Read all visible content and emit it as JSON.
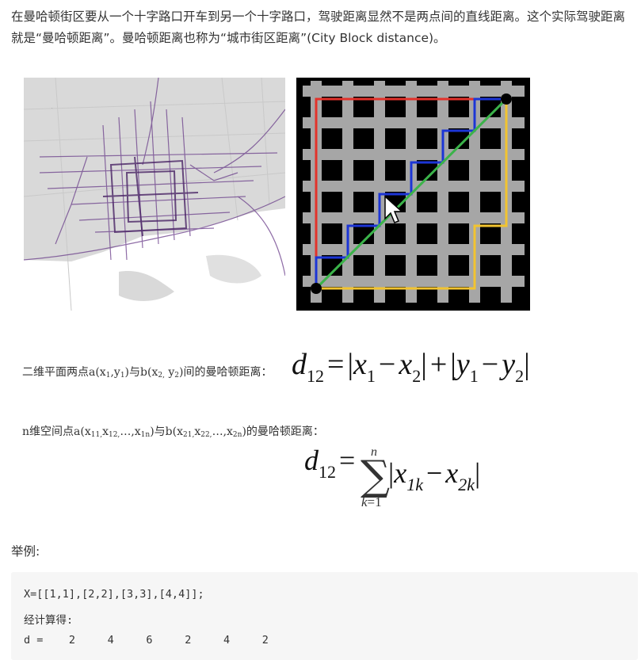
{
  "intro": {
    "paragraph": "在曼哈顿街区要从一个十字路口开车到另一个十字路口，驾驶距离显然不是两点间的直线距离。这个实际驾驶距离就是“曼哈顿距离”。曼哈顿距离也称为“城市街区距离”(City Block distance)。"
  },
  "images": {
    "left": "city-trajectory-map",
    "right": "manhattan-grid-paths"
  },
  "formula_2d": {
    "label_prefix": "二维平面两点",
    "label_a": "a(x",
    "label_a_s1": "1",
    "label_a_mid": ",y",
    "label_a_s2": "1",
    "label_a_end": ")",
    "label_mid": "与",
    "label_b": "b(x",
    "label_b_s1": "2,",
    "label_b_mid": " y",
    "label_b_s2": "2",
    "label_b_end": ")",
    "label_suffix": "间的曼哈顿距离：",
    "lhs": "d",
    "lhs_sub": "12",
    "x": "x",
    "x1_sub": "1",
    "x2_sub": "2",
    "y": "y",
    "y1_sub": "1",
    "y2_sub": "2"
  },
  "formula_nd": {
    "label_prefix": "n维空间点",
    "label_a": "a(x",
    "label_a_s1": "11,",
    "label_a_mid1": "x",
    "label_a_s2": "12,",
    "label_a_mid2": "…,x",
    "label_a_s3": "1n",
    "label_a_end": ")",
    "label_mid": "与",
    "label_b": "b(x",
    "label_b_s1": "21,",
    "label_b_mid1": "x",
    "label_b_s2": "22,",
    "label_b_mid2": "…,x",
    "label_b_s3": "2n",
    "label_b_end": ")",
    "label_suffix": "的曼哈顿距离：",
    "lhs": "d",
    "lhs_sub": "12",
    "sum_top": "n",
    "sum_bottom_var": "k",
    "sum_bottom_eq": "=1",
    "x": "x",
    "x1_sub": "1k",
    "x2_sub": "2k"
  },
  "example": {
    "label": "举例:",
    "code": {
      "line1": "X=[[1,1],[2,2],[3,3],[4,4]];",
      "line2": "经计算得:",
      "line3": "d =    2     4     6     2     4     2"
    }
  }
}
